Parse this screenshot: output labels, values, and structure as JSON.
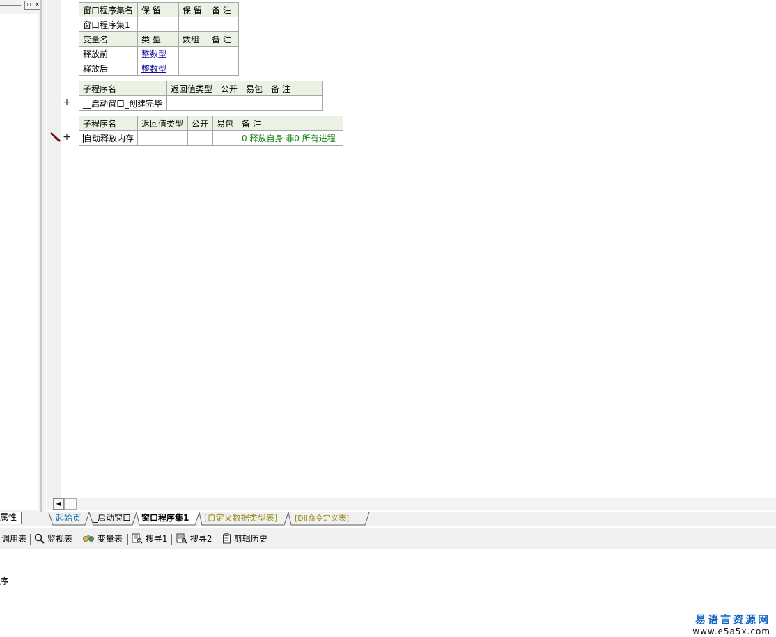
{
  "window": {
    "restore_glyph": "▫",
    "close_glyph": "×"
  },
  "table1": {
    "header": [
      "窗口程序集名",
      "保 留",
      "保 留",
      "备 注"
    ],
    "row": [
      "窗口程序集1",
      "",
      "",
      ""
    ]
  },
  "vars": {
    "header": [
      "变量名",
      "类 型",
      "数组",
      "备 注"
    ],
    "rows": [
      [
        "释放前",
        "整数型",
        "",
        ""
      ],
      [
        "释放后",
        "整数型",
        "",
        ""
      ]
    ]
  },
  "sub1": {
    "header": [
      "子程序名",
      "返回值类型",
      "公开",
      "易包",
      "备 注"
    ],
    "row": [
      "__启动窗口_创建完毕",
      "",
      "",
      "",
      ""
    ],
    "expand_glyph": "+"
  },
  "sub2": {
    "header": [
      "子程序名",
      "返回值类型",
      "公开",
      "易包",
      "备 注"
    ],
    "row": [
      "自动释放内存",
      "",
      "",
      "",
      "0 释放自身 非0 所有进程"
    ],
    "expand_glyph": "+"
  },
  "tabs": {
    "properties": "属性",
    "items": [
      "起始页",
      "_启动窗口",
      "窗口程序集1",
      "[自定义数据类型表]",
      "[Dll命令定义表]"
    ],
    "active_index": 2
  },
  "toolbar": {
    "items": [
      {
        "label": "调用表",
        "icon": ""
      },
      {
        "label": "监视表",
        "icon": "magnifier-icon"
      },
      {
        "label": "变量表",
        "icon": "variables-icon"
      },
      {
        "label": "搜寻1",
        "icon": "find-icon"
      },
      {
        "label": "搜寻2",
        "icon": "find-icon"
      },
      {
        "label": "剪辑历史",
        "icon": "clipboard-icon"
      }
    ]
  },
  "bottom": {
    "text": "序"
  },
  "watermark": {
    "name": "易语言资源网",
    "url": "www.e5a5x.com"
  },
  "colors": {
    "header_bg": "#ebf2e4",
    "link": "#0a0aa0",
    "comment": "#138013",
    "watermark": "#1565c0"
  }
}
